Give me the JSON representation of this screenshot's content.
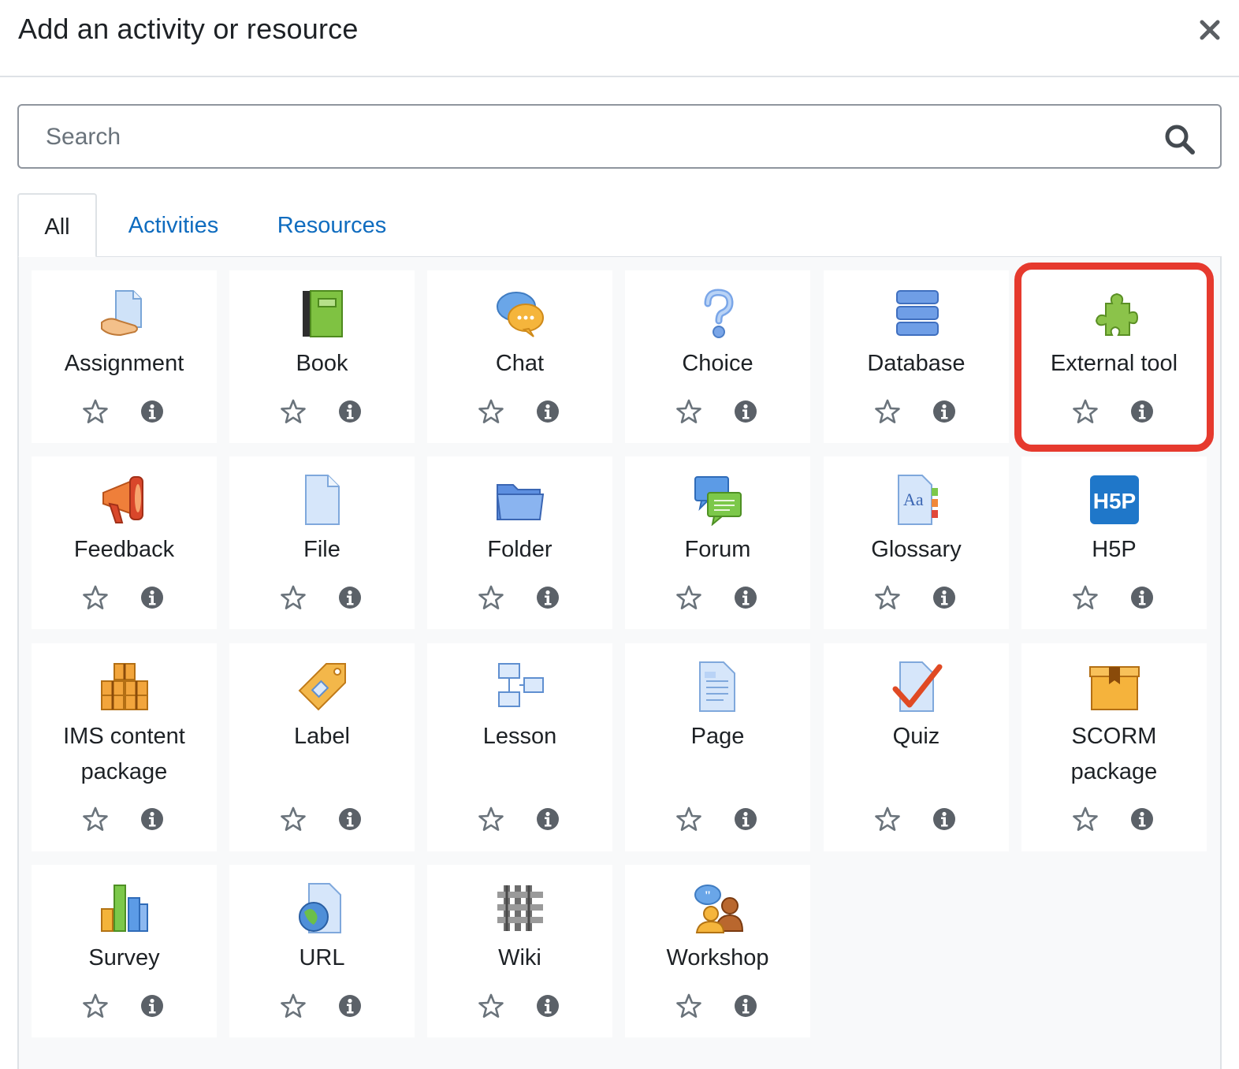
{
  "modal": {
    "title": "Add an activity or resource"
  },
  "search": {
    "placeholder": "Search",
    "value": ""
  },
  "tabs": [
    {
      "label": "All",
      "active": true
    },
    {
      "label": "Activities",
      "active": false
    },
    {
      "label": "Resources",
      "active": false
    }
  ],
  "modules": [
    {
      "label": "Assignment",
      "icon": "assignment-icon"
    },
    {
      "label": "Book",
      "icon": "book-icon"
    },
    {
      "label": "Chat",
      "icon": "chat-icon"
    },
    {
      "label": "Choice",
      "icon": "choice-icon"
    },
    {
      "label": "Database",
      "icon": "database-icon"
    },
    {
      "label": "External tool",
      "icon": "external-tool-icon",
      "highlighted": true
    },
    {
      "label": "Feedback",
      "icon": "feedback-icon"
    },
    {
      "label": "File",
      "icon": "file-icon"
    },
    {
      "label": "Folder",
      "icon": "folder-icon"
    },
    {
      "label": "Forum",
      "icon": "forum-icon"
    },
    {
      "label": "Glossary",
      "icon": "glossary-icon"
    },
    {
      "label": "H5P",
      "icon": "h5p-icon"
    },
    {
      "label": "IMS content\npackage",
      "icon": "ims-content-package-icon"
    },
    {
      "label": "Label",
      "icon": "label-icon"
    },
    {
      "label": "Lesson",
      "icon": "lesson-icon"
    },
    {
      "label": "Page",
      "icon": "page-icon"
    },
    {
      "label": "Quiz",
      "icon": "quiz-icon"
    },
    {
      "label": "SCORM\npackage",
      "icon": "scorm-package-icon"
    },
    {
      "label": "Survey",
      "icon": "survey-icon"
    },
    {
      "label": "URL",
      "icon": "url-icon"
    },
    {
      "label": "Wiki",
      "icon": "wiki-icon"
    },
    {
      "label": "Workshop",
      "icon": "workshop-icon"
    }
  ],
  "colors": {
    "link": "#0f6cbf",
    "highlight": "#e63a2e",
    "panel": "#f8f9fa",
    "text": "#1d2125"
  }
}
